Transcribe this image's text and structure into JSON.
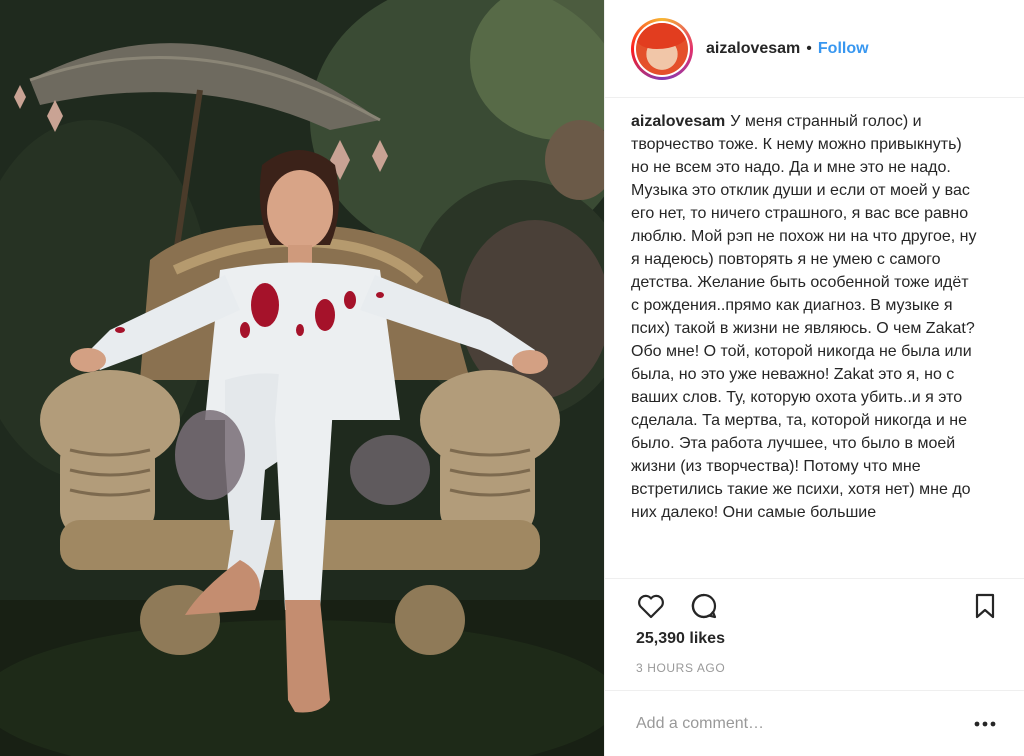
{
  "post": {
    "username": "aizalovesam",
    "separator": "•",
    "follow_label": "Follow",
    "caption_username": "aizalovesam",
    "caption_text": "У меня странный голос) и творчество тоже. К нему можно привыкнуть) но не всем это надо. Да и мне это не надо. Музыка это отклик души и если от моей у вас его нет, то ничего страшного, я вас все равно люблю. Мой рэп не похож ни на что другое, ну я надеюсь) повторять я не умею с самого детства. Желание быть особенной тоже идёт с рождения..прямо как диагноз. В музыке я псих) такой в жизни не являюсь. О чем Zakat? Обо мне! О той, которой никогда не была или была, но это уже неважно! Zakat это я, но с ваших слов. Ту, которую охота убить..и я это сделала. Та мертва, та, которой никогда и не было. Эта работа лучшее, что было в моей жизни (из творчества)! Потому что мне встретились такие же психи, хотя нет) мне до них далеко! Они самые большие",
    "likes": "25,390 likes",
    "time": "3 HOURS AGO",
    "comment_placeholder": "Add a comment…"
  },
  "icons": {
    "like": "heart-icon",
    "comment": "speech-bubble-icon",
    "save": "bookmark-icon",
    "more": "ellipsis-icon"
  },
  "colors": {
    "accent": "#3897f0",
    "text": "#262626",
    "muted": "#999999",
    "divider": "#efefef"
  }
}
